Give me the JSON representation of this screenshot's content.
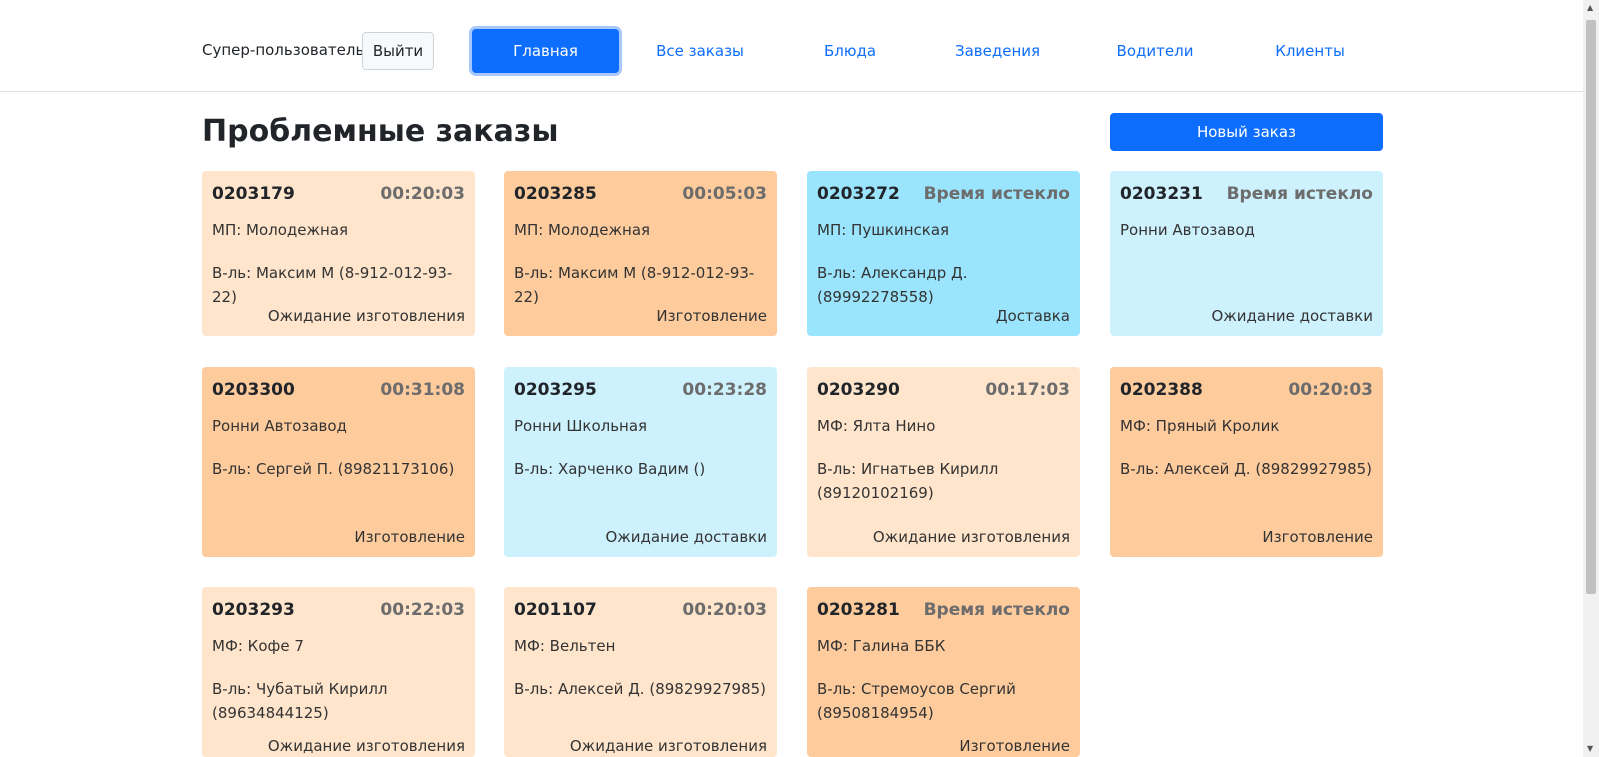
{
  "header": {
    "user_label": "Супер-пользователь",
    "logout_label": "Выйти",
    "nav": [
      {
        "label": "Главная"
      },
      {
        "label": "Все заказы"
      },
      {
        "label": "Блюда"
      },
      {
        "label": "Заведения"
      },
      {
        "label": "Водители"
      },
      {
        "label": "Клиенты"
      }
    ]
  },
  "main": {
    "title": "Проблемные заказы",
    "new_order_label": "Новый заказ"
  },
  "cards": [
    {
      "number": "0203179",
      "timer": "00:20:03",
      "place": "МП: Молодежная",
      "driver": "В-ль: Максим М (8-912-012-93-22)",
      "status": "Ожидание изготовления",
      "color": "#ffe5cc"
    },
    {
      "number": "0203285",
      "timer": "00:05:03",
      "place": "МП: Молодежная",
      "driver": "В-ль: Максим М (8-912-012-93-22)",
      "status": "Изготовление",
      "color": "#fecb9d"
    },
    {
      "number": "0203272",
      "timer": "Время истекло",
      "place": "МП: Пушкинская",
      "driver": "В-ль: Александр Д. (89992278558)",
      "status": "Доставка",
      "color": "#9be4fd"
    },
    {
      "number": "0203231",
      "timer": "Время истекло",
      "place": "Ронни Автозавод",
      "driver": "",
      "status": "Ожидание доставки",
      "color": "#cdf1fd"
    },
    {
      "number": "0203300",
      "timer": "00:31:08",
      "place": "Ронни Автозавод",
      "driver": "В-ль: Сергей П. (89821173106)",
      "status": "Изготовление",
      "color": "#fecb9d"
    },
    {
      "number": "0203295",
      "timer": "00:23:28",
      "place": "Ронни Школьная",
      "driver": "В-ль: Харченко Вадим ()",
      "status": "Ожидание доставки",
      "color": "#cdf1fd"
    },
    {
      "number": "0203290",
      "timer": "00:17:03",
      "place": "МФ: Ялта Нино",
      "driver": "В-ль: Игнатьев Кирилл (89120102169)",
      "status": "Ожидание изготовления",
      "color": "#ffe5cc"
    },
    {
      "number": "0202388",
      "timer": "00:20:03",
      "place": "МФ: Пряный Кролик",
      "driver": "В-ль: Алексей Д. (89829927985)",
      "status": "Изготовление",
      "color": "#fecb9d"
    },
    {
      "number": "0203293",
      "timer": "00:22:03",
      "place": "МФ: Кофе 7",
      "driver": "В-ль: Чубатый Кирилл (89634844125)",
      "status": "Ожидание изготовления",
      "color": "#ffe5cc"
    },
    {
      "number": "0201107",
      "timer": "00:20:03",
      "place": "МФ: Вельтен",
      "driver": "В-ль: Алексей Д. (89829927985)",
      "status": "Ожидание изготовления",
      "color": "#ffe5cc"
    },
    {
      "number": "0203281",
      "timer": "Время истекло",
      "place": "МФ: Галина ББК",
      "driver": "В-ль: Стремоусов Сергий (89508184954)",
      "status": "Изготовление",
      "color": "#fecb9d"
    }
  ]
}
